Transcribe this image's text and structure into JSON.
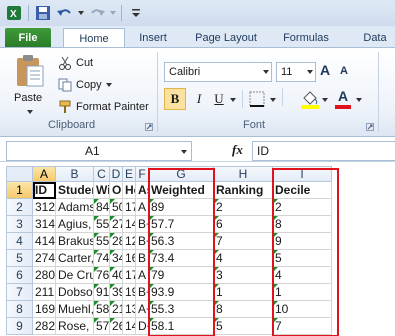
{
  "tabs": {
    "file": "File",
    "home": "Home",
    "insert": "Insert",
    "page_layout": "Page Layout",
    "formulas": "Formulas",
    "data": "Data"
  },
  "clipboard": {
    "paste": "Paste",
    "cut": "Cut",
    "copy": "Copy",
    "format_painter": "Format Painter",
    "label": "Clipboard"
  },
  "font": {
    "name": "Calibri",
    "size": "11",
    "label": "Font",
    "bold": "B",
    "italic": "I",
    "underline": "U",
    "grow": "A",
    "shrink": "A",
    "font_color": "A"
  },
  "formula_bar": {
    "name_box": "A1",
    "fx": "fx",
    "content": "ID"
  },
  "colors": {
    "accent_red": "#e0121c",
    "file_green": "#2a7b27",
    "indicator_green": "#1e8b2a"
  },
  "sheet": {
    "columns": [
      "A",
      "B",
      "C",
      "D",
      "E",
      "F",
      "G",
      "H",
      "I"
    ],
    "rows": [
      "1",
      "2",
      "3",
      "4",
      "5",
      "6",
      "7",
      "8",
      "9"
    ],
    "header_row": [
      "ID",
      "Student",
      "Wi",
      "Or",
      "Ho",
      "Ass",
      "Weighted",
      "Ranking",
      "Decile"
    ],
    "data": [
      [
        "312",
        "Adamski, A",
        "84",
        "50",
        "17",
        "A",
        "89",
        "2",
        "2"
      ],
      [
        "314",
        "Agius, Ant",
        "55",
        "27",
        "14",
        "B+",
        "57.7",
        "6",
        "8"
      ],
      [
        "414",
        "Brakus, St",
        "55",
        "28",
        "12",
        "B+",
        "56.3",
        "7",
        "9"
      ],
      [
        "274",
        "Carter, Ma",
        "74",
        "34",
        "16",
        "B",
        "73.4",
        "4",
        "5"
      ],
      [
        "280",
        "De Cruz, F",
        "76",
        "40",
        "17",
        "A",
        "79",
        "3",
        "4"
      ],
      [
        "211",
        "Dobson, A",
        "91",
        "39",
        "19",
        "B+",
        "93.9",
        "1",
        "1"
      ],
      [
        "169",
        "Muehl, Kri",
        "58",
        "21",
        "13",
        "A+",
        "55.3",
        "8",
        "10"
      ],
      [
        "282",
        "Rose, Reb",
        "57",
        "26",
        "14",
        "D+",
        "58.1",
        "5",
        "7"
      ]
    ]
  }
}
